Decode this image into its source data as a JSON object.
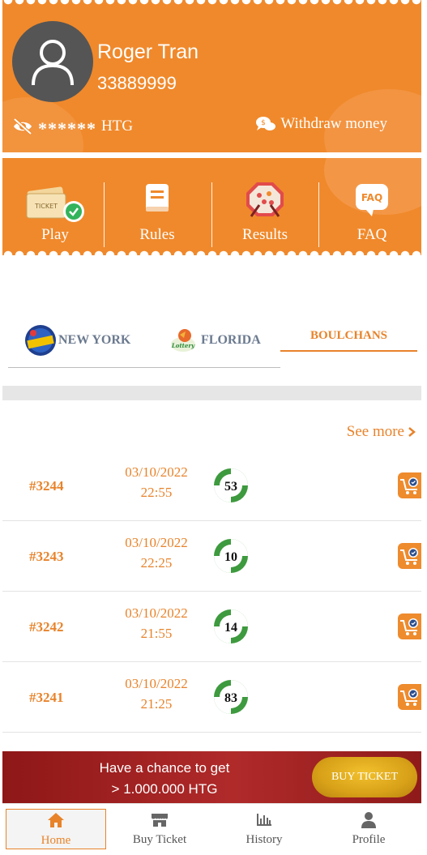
{
  "user": {
    "name": "Roger Tran",
    "phone": "33889999",
    "balance_masked": "******",
    "currency": "HTG",
    "withdraw_label": "Withdraw money"
  },
  "menu": [
    {
      "label": "Play",
      "icon": "ticket-icon"
    },
    {
      "label": "Rules",
      "icon": "book-icon"
    },
    {
      "label": "Results",
      "icon": "lottery-machine-icon"
    },
    {
      "label": "FAQ",
      "icon": "faq-icon"
    }
  ],
  "tabs": [
    {
      "label": "NEW YORK",
      "active": false
    },
    {
      "label": "FLORIDA",
      "active": false
    },
    {
      "label": "BOULCHANS",
      "active": true
    }
  ],
  "see_more": "See more",
  "results": [
    {
      "id": "#3244",
      "date": "03/10/2022",
      "time": "22:55",
      "number": "53"
    },
    {
      "id": "#3243",
      "date": "03/10/2022",
      "time": "22:25",
      "number": "10"
    },
    {
      "id": "#3242",
      "date": "03/10/2022",
      "time": "21:55",
      "number": "14"
    },
    {
      "id": "#3241",
      "date": "03/10/2022",
      "time": "21:25",
      "number": "83"
    }
  ],
  "promo": {
    "line1": "Have a chance to get",
    "line2": "> 1.000.000 HTG",
    "button": "BUY TICKET"
  },
  "bottom_nav": [
    {
      "label": "Home",
      "icon": "home-icon",
      "active": true
    },
    {
      "label": "Buy Ticket",
      "icon": "store-icon",
      "active": false
    },
    {
      "label": "History",
      "icon": "bar-chart-icon",
      "active": false
    },
    {
      "label": "Profile",
      "icon": "person-icon",
      "active": false
    }
  ],
  "colors": {
    "accent": "#F0892B",
    "text_accent": "#E8832A",
    "promo_red": "#A52222",
    "gold": "#D8A118"
  }
}
